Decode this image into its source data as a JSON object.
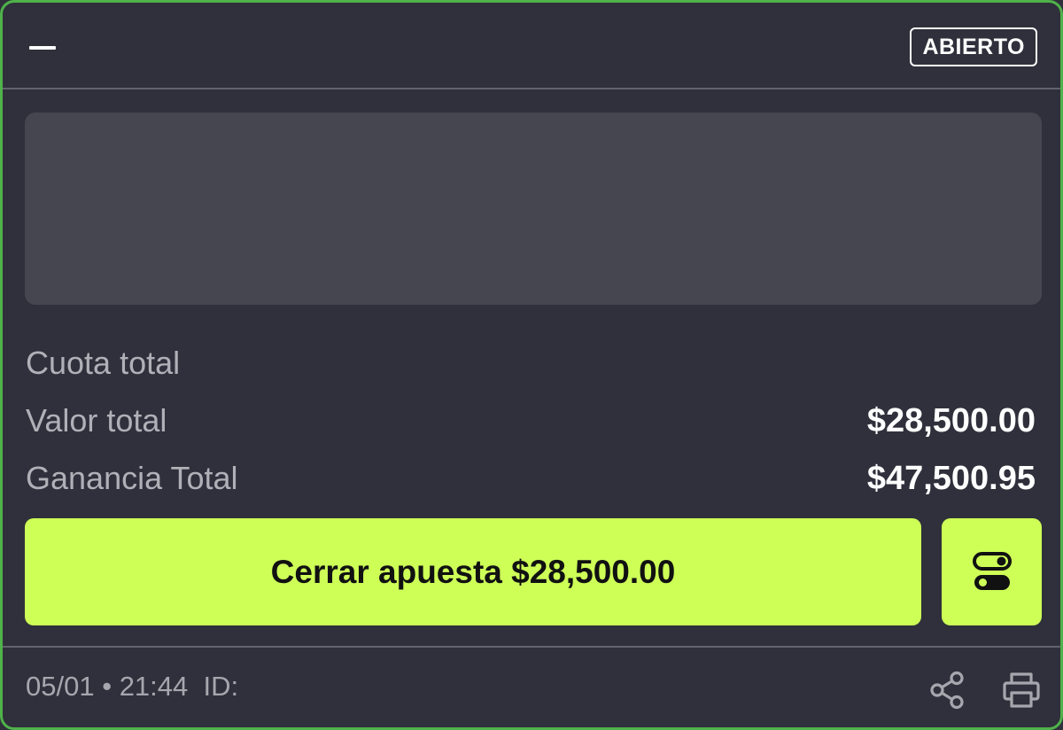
{
  "header": {
    "status_badge": "ABIERTO"
  },
  "summary": {
    "rows": [
      {
        "label": "Cuota total",
        "value": ""
      },
      {
        "label": "Valor total",
        "value": "$28,500.00"
      },
      {
        "label": "Ganancia Total",
        "value": "$47,500.95"
      }
    ]
  },
  "actions": {
    "cashout_label": "Cerrar apuesta $28,500.00"
  },
  "footer": {
    "date": "05/01",
    "separator": "•",
    "time": "21:44",
    "id_label": "ID:"
  },
  "icons": {
    "collapse": "minus-icon",
    "toggle": "toggle-switches-icon",
    "share": "share-icon",
    "print": "print-icon"
  },
  "colors": {
    "background": "#2f303b",
    "border_accent": "#4fb24a",
    "button": "#cdff57",
    "panel": "#464650",
    "muted_text": "#b0b1b8"
  }
}
